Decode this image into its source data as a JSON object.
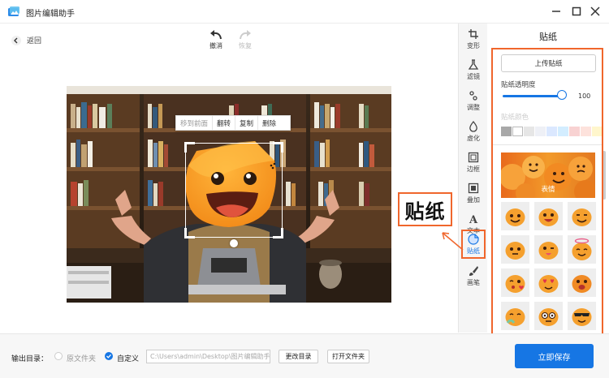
{
  "window": {
    "title": "图片编辑助手"
  },
  "toolbar": {
    "back_label": "返回",
    "undo_label": "撤消",
    "redo_label": "恢复"
  },
  "context_menu": {
    "items": [
      "移到前面",
      "翻转",
      "复制",
      "删除"
    ]
  },
  "tools": [
    {
      "label": "变形",
      "icon": "crop-icon"
    },
    {
      "label": "滤镜",
      "icon": "flask-icon"
    },
    {
      "label": "调整",
      "icon": "adjust-icon"
    },
    {
      "label": "虚化",
      "icon": "drop-icon"
    },
    {
      "label": "边框",
      "icon": "frame-icon"
    },
    {
      "label": "叠加",
      "icon": "overlay-icon"
    },
    {
      "label": "文本",
      "icon": "text-icon"
    },
    {
      "label": "贴纸",
      "icon": "sticker-icon",
      "active": true
    },
    {
      "label": "画笔",
      "icon": "brush-icon"
    }
  ],
  "panel": {
    "title": "贴纸",
    "upload_label": "上传贴纸",
    "opacity_label": "贴纸透明度",
    "opacity_value": "100",
    "color_label": "贴纸颜色",
    "swatches": [
      "#a8a8a8",
      "#ffffff",
      "#e6e6e6",
      "#eef0f6",
      "#dbe8ff",
      "#d3edff",
      "#f8d2d2",
      "#fde2dc",
      "#fff6cc"
    ],
    "banner_label": "表情"
  },
  "callout": {
    "text": "贴纸"
  },
  "footer": {
    "output_label": "输出目录：",
    "radio_original": "原文件夹",
    "radio_custom": "自定义",
    "path_value": "C:\\Users\\admin\\Desktop\\图片编辑助手",
    "change_dir_label": "更改目录",
    "open_folder_label": "打开文件夹",
    "save_label": "立即保存"
  },
  "colors": {
    "accent": "#1676e4",
    "highlight": "#f0662c"
  }
}
